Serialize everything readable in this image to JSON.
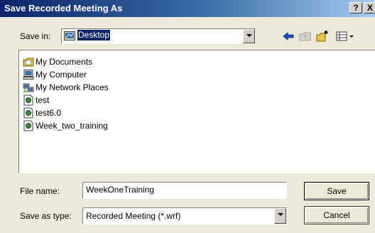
{
  "window": {
    "title": "Save Recorded Meeting As",
    "help_glyph": "?",
    "close_glyph": "X"
  },
  "save_in": {
    "label": "Save in:",
    "value": "Desktop"
  },
  "toolbar_icons": [
    "back-arrow-icon",
    "up-folder-icon",
    "new-folder-icon",
    "view-menu-icon"
  ],
  "file_list": [
    {
      "name": "My Documents",
      "icon": "my-documents-icon"
    },
    {
      "name": "My Computer",
      "icon": "my-computer-icon"
    },
    {
      "name": "My Network Places",
      "icon": "network-places-icon"
    },
    {
      "name": "test",
      "icon": "wrf-file-icon"
    },
    {
      "name": "test6.0",
      "icon": "wrf-file-icon"
    },
    {
      "name": "Week_two_training",
      "icon": "wrf-file-icon"
    }
  ],
  "file_name": {
    "label": "File name:",
    "value": "WeekOneTraining"
  },
  "save_as_type": {
    "label": "Save as type:",
    "value": "Recorded Meeting (*.wrf)"
  },
  "buttons": {
    "save": "Save",
    "cancel": "Cancel"
  },
  "colors": {
    "title_bar": "#0a246a",
    "dialog_bg": "#ece9d8",
    "selection": "#0a246a"
  }
}
